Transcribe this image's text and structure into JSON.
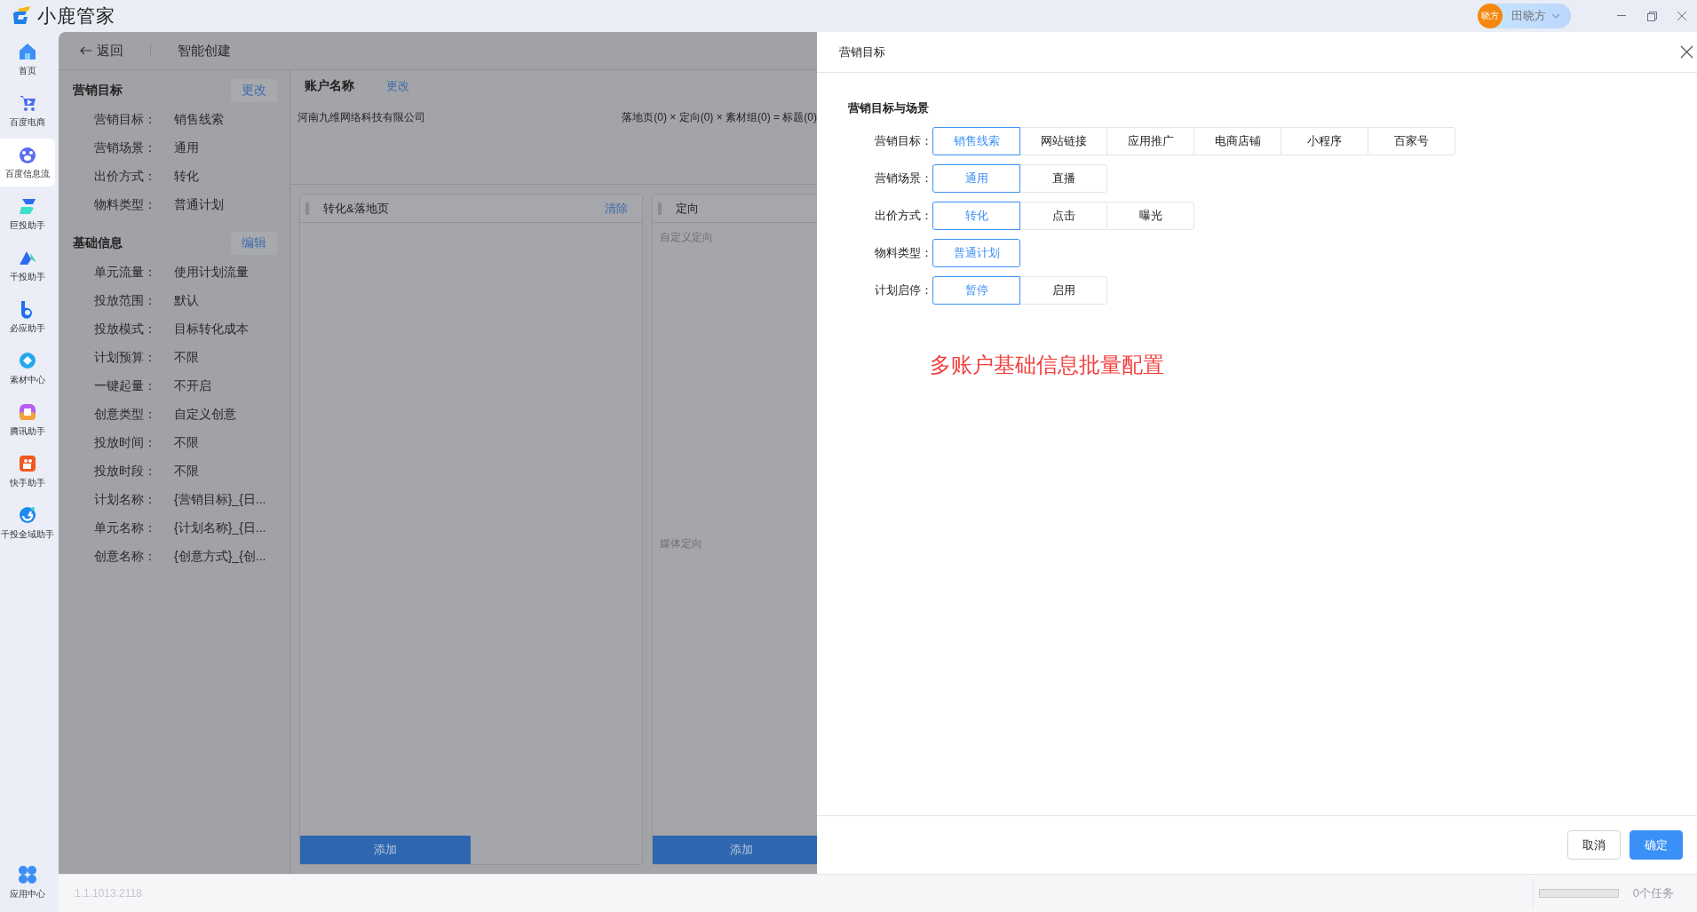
{
  "app": {
    "name": "小鹿管家"
  },
  "user": {
    "avatar_text": "晓方",
    "name": "田晓方"
  },
  "sidebar": {
    "items": [
      {
        "label": "首页",
        "selected": false
      },
      {
        "label": "百度电商",
        "selected": false
      },
      {
        "label": "百度信息流",
        "selected": true
      },
      {
        "label": "巨投助手",
        "selected": false
      },
      {
        "label": "千投助手",
        "selected": false
      },
      {
        "label": "必应助手",
        "selected": false
      },
      {
        "label": "素材中心",
        "selected": false
      },
      {
        "label": "腾讯助手",
        "selected": false
      },
      {
        "label": "快手助手",
        "selected": false
      },
      {
        "label": "千投全域助手",
        "selected": false
      }
    ],
    "footer_item": {
      "label": "应用中心"
    }
  },
  "summary": {
    "back": "返回",
    "title": "智能创建",
    "sections": [
      {
        "title": "营销目标",
        "action": "更改",
        "rows": [
          {
            "label": "营销目标：",
            "value": "销售线索"
          },
          {
            "label": "营销场景：",
            "value": "通用"
          },
          {
            "label": "出价方式：",
            "value": "转化"
          },
          {
            "label": "物料类型：",
            "value": "普通计划"
          }
        ]
      },
      {
        "title": "基础信息",
        "action": "编辑",
        "rows": [
          {
            "label": "单元流量：",
            "value": "使用计划流量"
          },
          {
            "label": "投放范围：",
            "value": "默认"
          },
          {
            "label": "投放模式：",
            "value": "目标转化成本"
          },
          {
            "label": "计划预算：",
            "value": "不限"
          },
          {
            "label": "一键起量：",
            "value": "不开启"
          },
          {
            "label": "创意类型：",
            "value": "自定义创意"
          },
          {
            "label": "投放时间：",
            "value": "不限"
          },
          {
            "label": "投放时段：",
            "value": "不限"
          },
          {
            "label": "计划名称：",
            "value": "{营销目标}_{日..."
          },
          {
            "label": "单元名称：",
            "value": "{计划名称}_{日..."
          },
          {
            "label": "创意名称：",
            "value": "{创意方式}_{创..."
          }
        ]
      }
    ]
  },
  "workspace": {
    "account_heading": "账户名称",
    "account_action": "更改",
    "account": "河南九维网络科技有限公司",
    "formula": "落地页(0) × 定向(0) × 素材组(0) = 标题(0)",
    "cards": [
      {
        "title": "转化&落地页",
        "action": "清除",
        "button": "添加"
      },
      {
        "title": "定向",
        "placeholders": [
          "自定义定向",
          "媒体定向"
        ],
        "button": "添加"
      }
    ]
  },
  "drawer": {
    "title": "营销目标",
    "section_title": "营销目标与场景",
    "fields": [
      {
        "label": "营销目标：",
        "options": [
          {
            "label": "销售线索",
            "selected": true
          },
          {
            "label": "网站链接",
            "selected": false
          },
          {
            "label": "应用推广",
            "selected": false
          },
          {
            "label": "电商店铺",
            "selected": false
          },
          {
            "label": "小程序",
            "selected": false
          },
          {
            "label": "百家号",
            "selected": false
          }
        ]
      },
      {
        "label": "营销场景：",
        "options": [
          {
            "label": "通用",
            "selected": true
          },
          {
            "label": "直播",
            "selected": false
          }
        ]
      },
      {
        "label": "出价方式：",
        "options": [
          {
            "label": "转化",
            "selected": true
          },
          {
            "label": "点击",
            "selected": false
          },
          {
            "label": "曝光",
            "selected": false
          }
        ]
      },
      {
        "label": "物料类型：",
        "options": [
          {
            "label": "普通计划",
            "selected": true
          }
        ]
      },
      {
        "label": "计划启停：",
        "options": [
          {
            "label": "暂停",
            "selected": true
          },
          {
            "label": "启用",
            "selected": false
          }
        ]
      }
    ],
    "note": "多账户基础信息批量配置",
    "buttons": [
      {
        "label": "取消",
        "kind": "secondary"
      },
      {
        "label": "确定",
        "kind": "primary"
      }
    ]
  },
  "status_bar": {
    "version": "1.1.1013.2118",
    "level": 0,
    "tasks": "0个任务"
  }
}
